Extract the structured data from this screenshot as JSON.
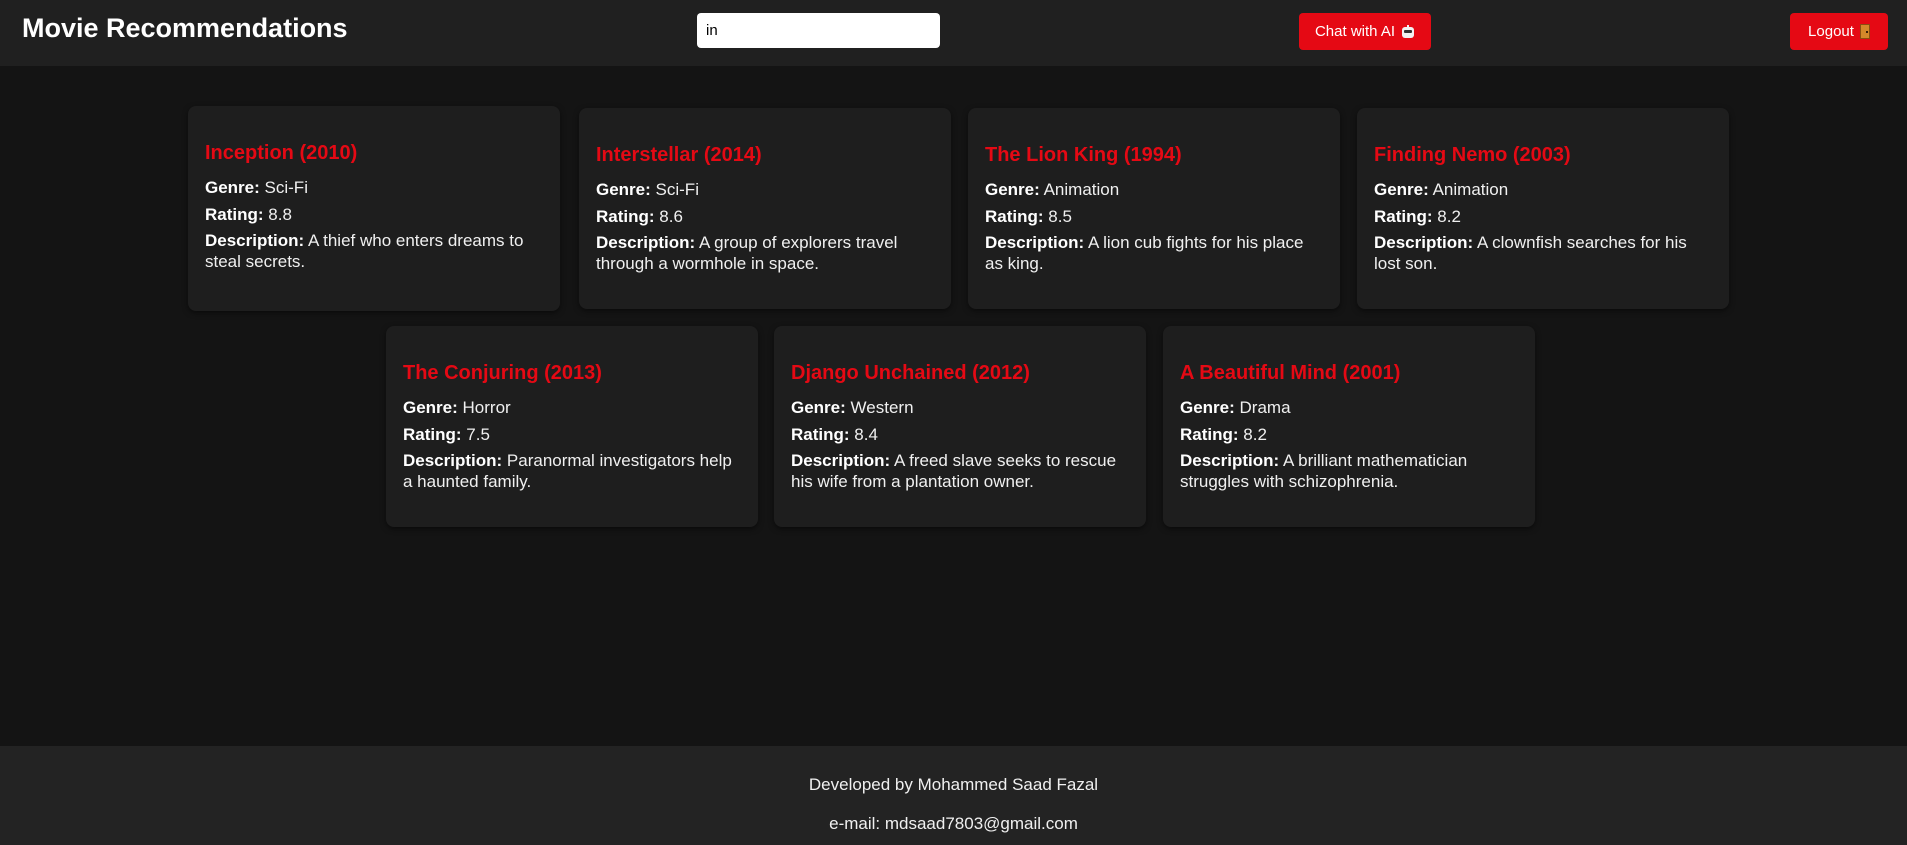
{
  "header": {
    "title": "Movie Recommendations",
    "search_value": "in",
    "chat_label": "Chat with AI",
    "logout_label": "Logout",
    "accent_color": "#e50914"
  },
  "labels": {
    "genre": "Genre:",
    "rating": "Rating:",
    "description": "Description:"
  },
  "movies": [
    {
      "title": "Inception (2010)",
      "genre": "Sci-Fi",
      "rating": "8.8",
      "description": "A thief who enters dreams to steal secrets."
    },
    {
      "title": "Interstellar (2014)",
      "genre": "Sci-Fi",
      "rating": "8.6",
      "description": "A group of explorers travel through a wormhole in space."
    },
    {
      "title": "The Lion King (1994)",
      "genre": "Animation",
      "rating": "8.5",
      "description": "A lion cub fights for his place as king."
    },
    {
      "title": "Finding Nemo (2003)",
      "genre": "Animation",
      "rating": "8.2",
      "description": "A clownfish searches for his lost son."
    },
    {
      "title": "The Conjuring (2013)",
      "genre": "Horror",
      "rating": "7.5",
      "description": "Paranormal investigators help a haunted family."
    },
    {
      "title": "Django Unchained (2012)",
      "genre": "Western",
      "rating": "8.4",
      "description": "A freed slave seeks to rescue his wife from a plantation owner."
    },
    {
      "title": "A Beautiful Mind (2001)",
      "genre": "Drama",
      "rating": "8.2",
      "description": "A brilliant mathematician struggles with schizophrenia."
    }
  ],
  "footer": {
    "developer": "Developed by Mohammed Saad Fazal",
    "email": "e-mail: mdsaad7803@gmail.com"
  },
  "icons": {
    "chat_button": "robot-icon",
    "logout_button": "door-icon"
  }
}
